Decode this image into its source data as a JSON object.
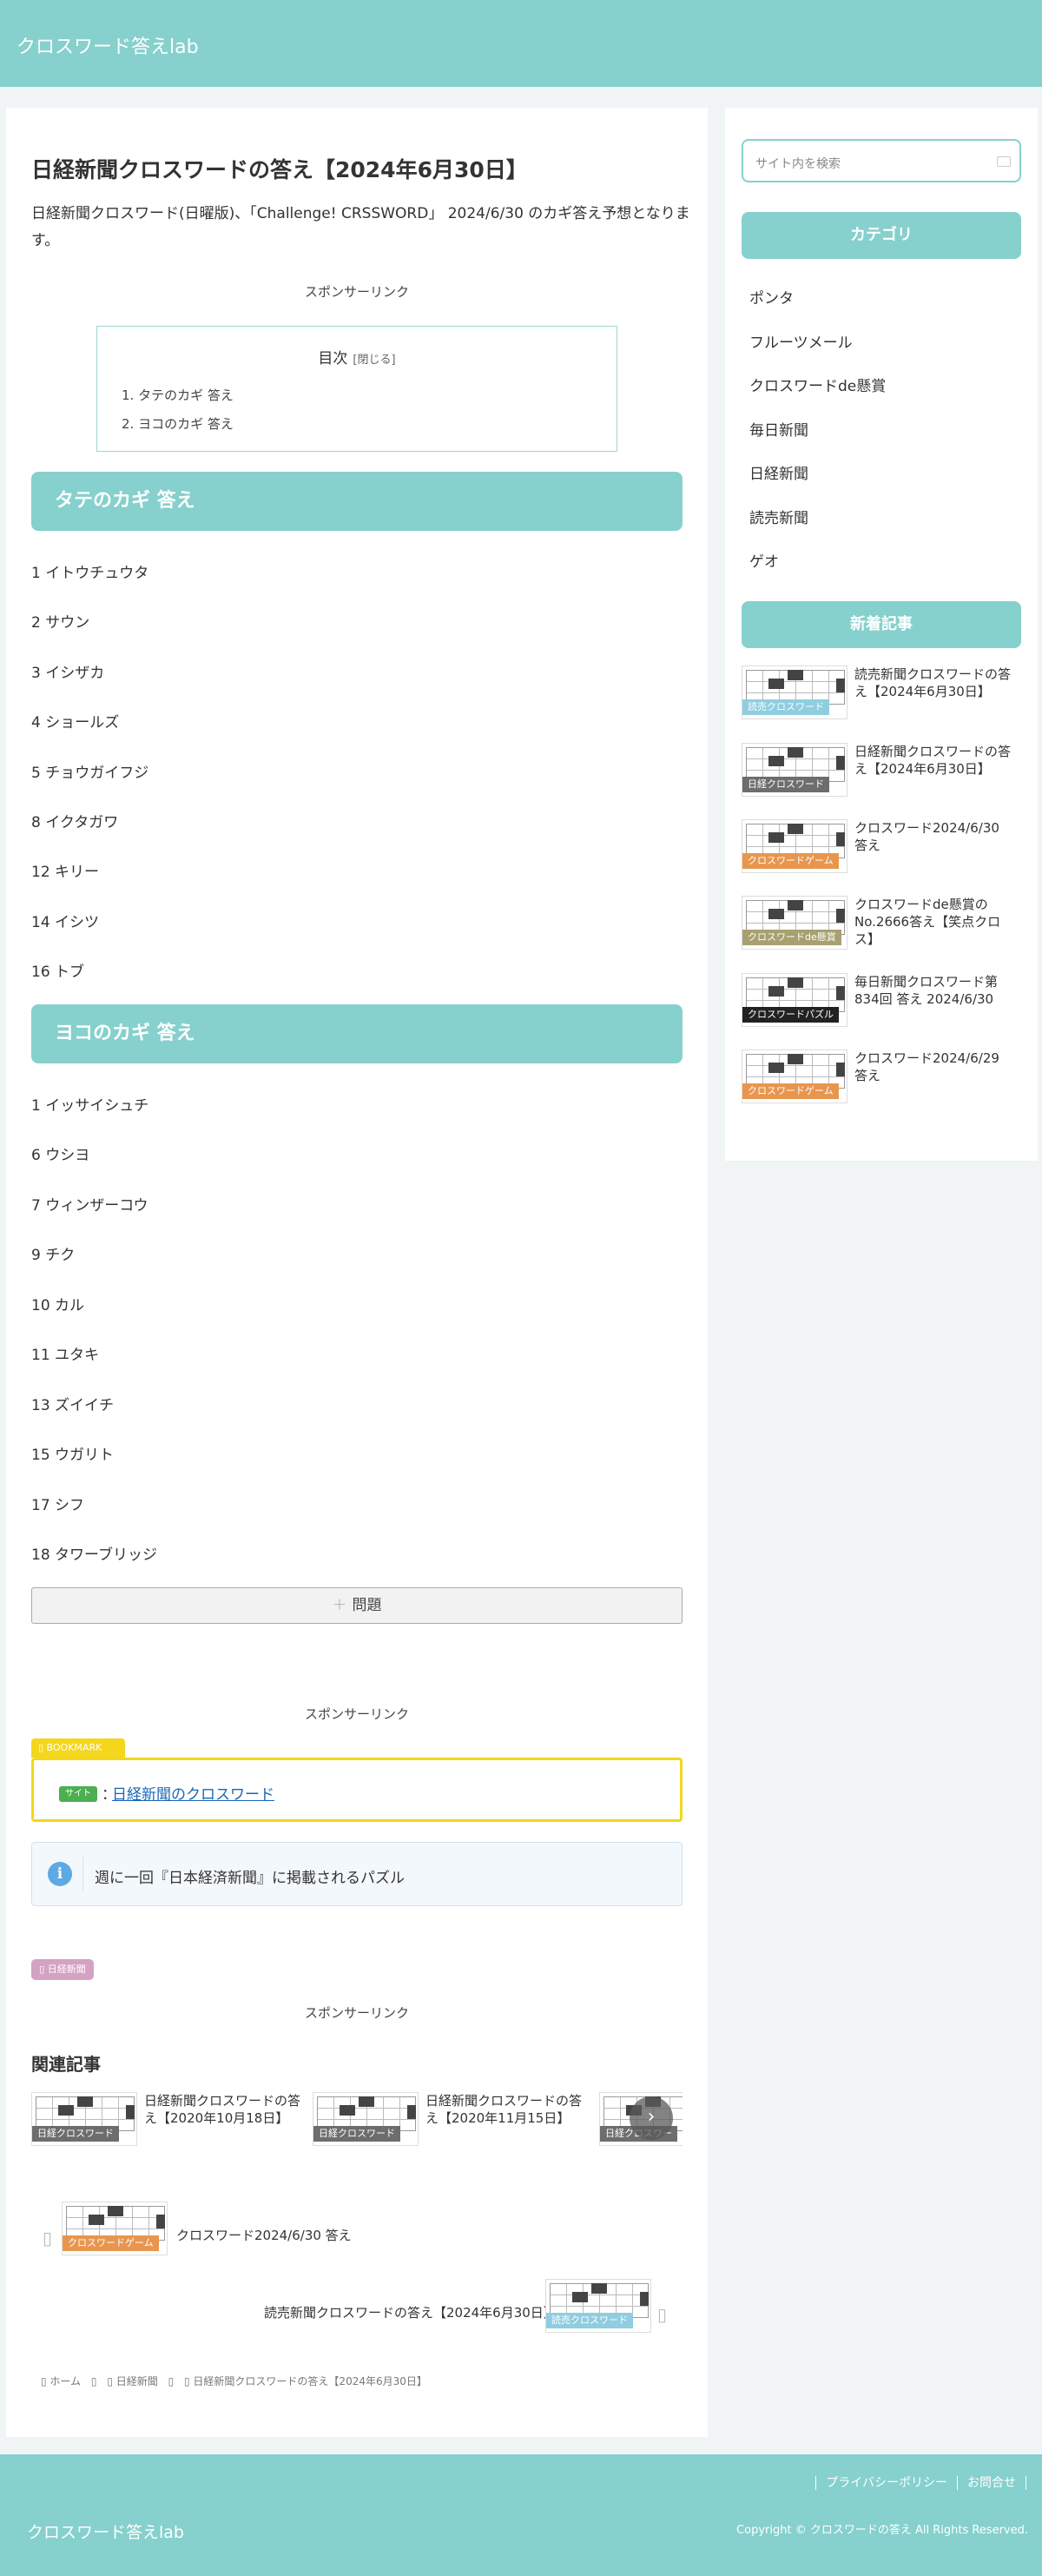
{
  "header": {
    "site_title": "クロスワード答えlab"
  },
  "post": {
    "title": "日経新聞クロスワードの答え【2024年6月30日】",
    "lead": "日経新聞クロスワード(日曜版)、「Challenge! CRSSWORD」 2024/6/30 のカギ答え予想となります。",
    "sponsor_label": "スポンサーリンク"
  },
  "toc": {
    "title": "目次",
    "toggle": "[閉じる]",
    "items": [
      "1. タテのカギ 答え",
      "2. ヨコのカギ 答え"
    ]
  },
  "tate": {
    "heading": "タテのカギ 答え",
    "answers": [
      "1 イトウチュウタ",
      "2 サウン",
      "3 イシザカ",
      "4 ショールズ",
      "5 チョウガイフジ",
      "8 イクタガワ",
      "12 キリー",
      "14 イシツ",
      "16 トブ"
    ]
  },
  "yoko": {
    "heading": "ヨコのカギ 答え",
    "answers": [
      "1 イッサイシュチ",
      "6 ウシヨ",
      "7 ウィンザーコウ",
      "9 チク",
      "10 カル",
      "11 ユタキ",
      "13 ズイイチ",
      "15 ウガリト",
      "17 シフ",
      "18 タワーブリッジ"
    ]
  },
  "question_toggle": {
    "plus": "＋",
    "label": "問題"
  },
  "bookmark": {
    "tag": "▯ BOOKMARK",
    "badge": "サイト",
    "colon": "：",
    "link": "日経新聞のクロスワード"
  },
  "info": {
    "icon": "i",
    "text": "週に一回『日本経済新聞』に掲載されるパズル"
  },
  "category_tag": "▯ 日経新聞",
  "related": {
    "title": "関連記事",
    "cards": [
      {
        "title": "日経新聞クロスワードの答え【2020年10月18日】",
        "label": "日経クロスワード",
        "color": "#6d6d6d"
      },
      {
        "title": "日経新聞クロスワードの答え【2020年11月15日】",
        "label": "日経クロスワード",
        "color": "#6d6d6d"
      },
      {
        "title": "",
        "label": "日経クロスワー",
        "color": "#6d6d6d"
      }
    ],
    "next_arrow": "›"
  },
  "post_nav": {
    "prev": {
      "arrow": "▯",
      "title": "クロスワード2024/6/30 答え",
      "label": "クロスワードゲーム",
      "color": "#e8964e"
    },
    "next": {
      "arrow": "▯",
      "title": "読売新聞クロスワードの答え【2024年6月30日】",
      "label": "読売クロスワード",
      "color": "#8fcde0"
    }
  },
  "breadcrumb": [
    "▯ ホーム",
    "▯",
    "▯ 日経新聞",
    "▯",
    "▯ 日経新聞クロスワードの答え【2024年6月30日】"
  ],
  "sidebar": {
    "search_placeholder": "サイト内を検索",
    "category_heading": "カテゴリ",
    "categories": [
      "ポンタ",
      "フルーツメール",
      "クロスワードde懸賞",
      "毎日新聞",
      "日経新聞",
      "読売新聞",
      "ゲオ"
    ],
    "news_heading": "新着記事",
    "news": [
      {
        "title": "読売新聞クロスワードの答え【2024年6月30日】",
        "label": "読売クロスワード",
        "color": "#8fcde0"
      },
      {
        "title": "日経新聞クロスワードの答え【2024年6月30日】",
        "label": "日経クロスワード",
        "color": "#6d6d6d"
      },
      {
        "title": "クロスワード2024/6/30 答え",
        "label": "クロスワードゲーム",
        "color": "#e8964e"
      },
      {
        "title": "クロスワードde懸賞のNo.2666答え【笑点クロス】",
        "label": "クロスワードde懸賞",
        "color": "#a8a070"
      },
      {
        "title": "毎日新聞クロスワード第834回 答え 2024/6/30",
        "label": "クロスワードパズル",
        "color": "#222222"
      },
      {
        "title": "クロスワード2024/6/29 答え",
        "label": "クロスワードゲーム",
        "color": "#e8964e"
      }
    ]
  },
  "footer": {
    "site_title": "クロスワード答えlab",
    "links": [
      "プライバシーポリシー",
      "お問合せ"
    ],
    "copyright": "Copyright © クロスワードの答え All Rights Reserved."
  }
}
